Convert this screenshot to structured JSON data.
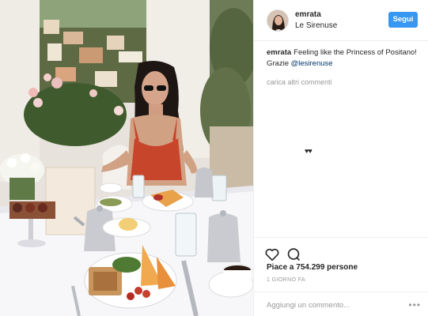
{
  "post": {
    "username": "emrata",
    "location": "Le Sirenuse",
    "follow_label": "Segui",
    "caption": {
      "author": "emrata",
      "text": "Feeling like the Princess of Positano! Grazie ",
      "mention": "@lesirenuse"
    },
    "load_more_comments": "carica altri commenti",
    "emoji": "♥♥",
    "likes": "Piace a 754.299 persone",
    "time_ago": "1 GIORNO FA",
    "comment_placeholder": "Aggiungi un commento...",
    "more_options": "•••"
  },
  "colors": {
    "follow_button": "#3897f0",
    "mention": "#003569",
    "muted": "#999999",
    "dress": "#c7452b"
  },
  "icons": [
    "heart-icon",
    "comment-icon",
    "more-options-icon"
  ]
}
